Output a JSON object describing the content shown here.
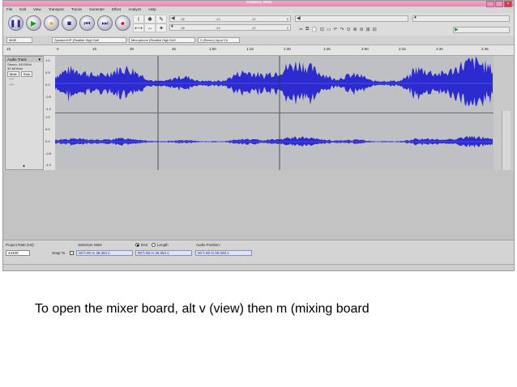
{
  "window": {
    "title": "Audacity Beta"
  },
  "menu": [
    "File",
    "Edit",
    "View",
    "Transport",
    "Tracks",
    "Generate",
    "Effect",
    "Analyze",
    "Help"
  ],
  "transport": [
    {
      "name": "pause",
      "glyph": "❚❚",
      "color": "#2a2a9a"
    },
    {
      "name": "play",
      "glyph": "▶",
      "color": "#1a9a1a"
    },
    {
      "name": "loop",
      "glyph": "●",
      "color": "#e8b400"
    },
    {
      "name": "stop",
      "glyph": "■",
      "color": "#2a2a9a"
    },
    {
      "name": "skip-start",
      "glyph": "⏮",
      "color": "#2a2a9a"
    },
    {
      "name": "skip-end",
      "glyph": "⏭",
      "color": "#2a2a9a"
    },
    {
      "name": "record",
      "glyph": "●",
      "color": "#c81e1e"
    }
  ],
  "tools": [
    "I",
    "✱",
    "✎",
    "⟷",
    "⇔",
    "✦"
  ],
  "meters": {
    "playback_scale": [
      "-36",
      "-24",
      "-12",
      "0"
    ],
    "record_scale": [
      "-36",
      "-24",
      "-12",
      "0"
    ]
  },
  "devices": {
    "host": "MME",
    "speaker": "Speaker/HP (Realtek High Defi",
    "microphone": "Microphone (Realtek High Defi",
    "channels": "2 (Stereo) Input Ch"
  },
  "ruler": [
    "15",
    "0",
    "15",
    "30",
    "45",
    "1:00",
    "1:15",
    "1:30",
    "1:45",
    "2:00",
    "2:15",
    "2:30",
    "2:45"
  ],
  "track": {
    "name": "Audio Track",
    "info": [
      "Stereo, 44100Hz",
      "32-bit float"
    ],
    "mute": "Mute",
    "solo": "Solo",
    "scale": [
      "1.0",
      "0.5",
      "0.0",
      "-0.5",
      "-1.0",
      "1.0",
      "0.5",
      "0.0",
      "-0.5",
      "-1.0"
    ]
  },
  "selection": {
    "rate_label": "Project Rate (Hz):",
    "rate_value": "44100",
    "snap_label": "Snap To",
    "start_label": "Selection Start:",
    "end_label": "End",
    "length_label": "Length",
    "pos_label": "Audio Position:",
    "start_value": "00 h 00 m 38.364 s",
    "end_value": "00 h 00 m 38.364 s",
    "pos_value": "00 h 00 m 00.000 s"
  },
  "caption": "To open the mixer board, alt v (view) then m (mixing board"
}
